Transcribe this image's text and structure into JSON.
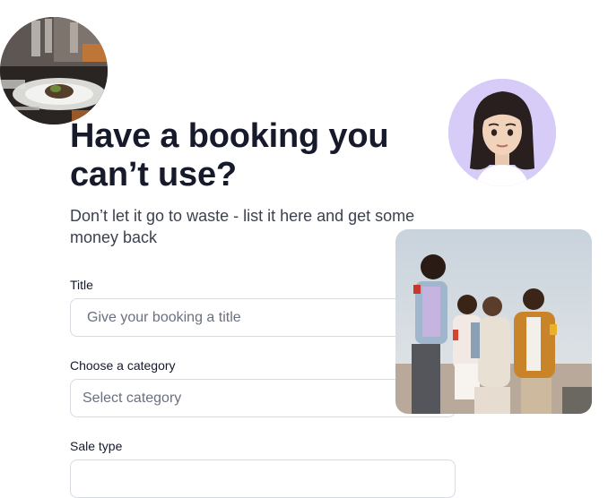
{
  "heading": {
    "line1": "Have a booking you",
    "line2": "can’t use?"
  },
  "subtitle": "Don’t let it go to waste - list it here and get some money back",
  "form": {
    "title_label": "Title",
    "title_placeholder": "Give your booking a title",
    "category_label": "Choose a category",
    "category_placeholder": "Select category",
    "sale_type_label": "Sale type"
  },
  "images": {
    "restaurant_photo": "restaurant-table-photo",
    "avatar": "woman-avatar-illustration",
    "friends_photo": "group-of-friends-photo"
  },
  "colors": {
    "heading": "#161a2b",
    "avatar_background": "#d7ccf7",
    "field_border": "#d8dbe2",
    "placeholder": "#6b7080"
  }
}
